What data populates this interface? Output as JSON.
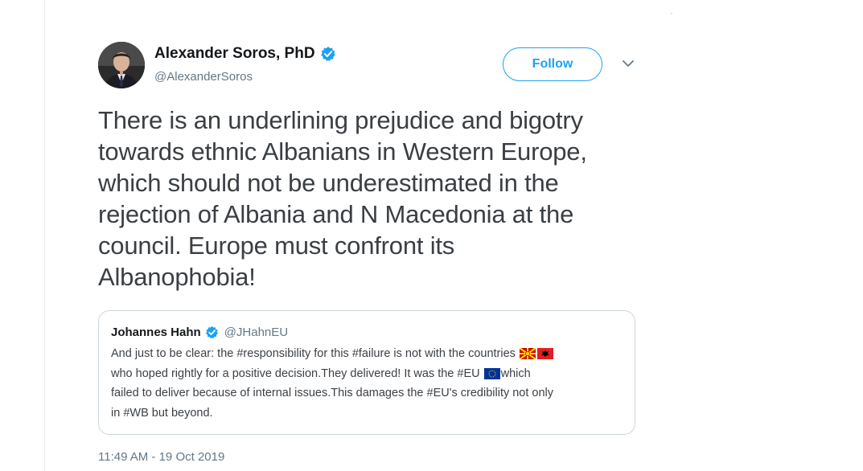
{
  "author": {
    "display_name": "Alexander Soros, PhD",
    "handle": "@AlexanderSoros",
    "verified": true
  },
  "actions": {
    "follow_label": "Follow",
    "menu_icon": "chevron-down-icon"
  },
  "tweet": {
    "lines": [
      "There is an underlining prejudice and bigotry",
      "towards ethnic Albanians in Western Europe,",
      "which should not be underestimated in the",
      "rejection of Albania and N Macedonia at the",
      "council. Europe must confront its",
      "Albanophobia!"
    ],
    "timestamp": "11:49 AM - 19 Oct 2019"
  },
  "quoted_tweet": {
    "display_name": "Johannes Hahn",
    "handle": "@JHahnEU",
    "verified": true,
    "line1": "And just to be clear: the #responsibility for this #failure is not with the countries",
    "line2a": "who hoped rightly for a positive decision.They delivered! It was the #EU",
    "line2b": "which",
    "line3": "failed to deliver because of internal issues.This damages the #EU's credibility not only",
    "line4": "in #WB but beyond.",
    "flags": [
      "north-macedonia-flag",
      "albania-flag",
      "eu-flag"
    ]
  },
  "colors": {
    "accent": "#1da1f2",
    "text_primary": "#14171a",
    "text_secondary": "#657786",
    "border": "#ccd6dd"
  }
}
